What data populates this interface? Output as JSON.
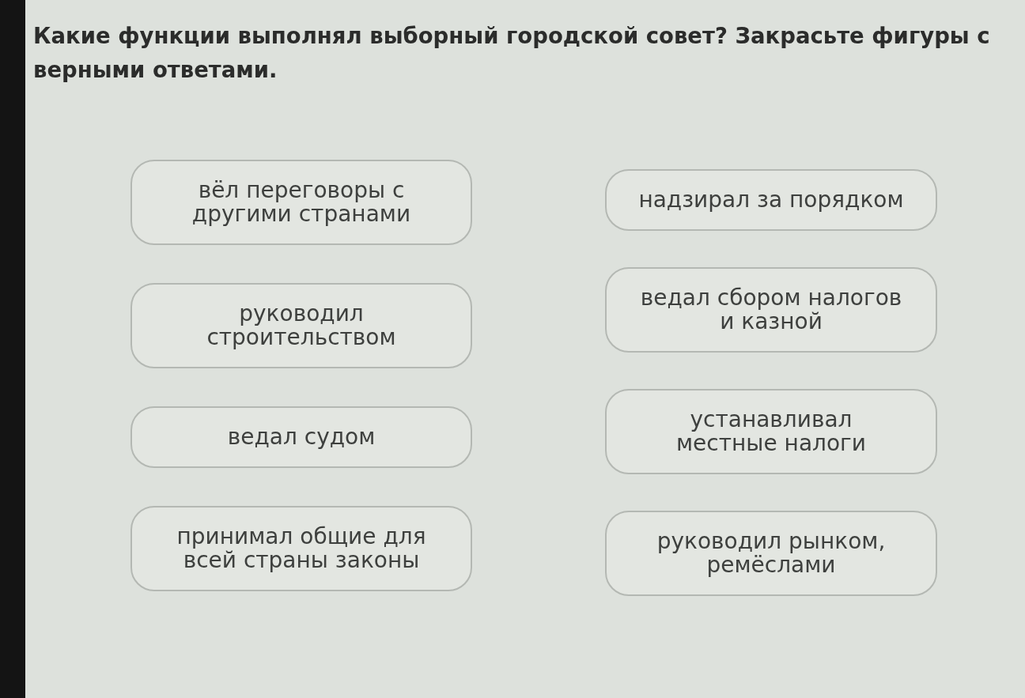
{
  "question": {
    "text": "Какие функции выполнял выборный городской совет? Закрасьте фигуры с верными ответами."
  },
  "options": [
    {
      "text": "вёл переговоры с другими странами",
      "selected": false
    },
    {
      "text": "руководил строительством",
      "selected": false
    },
    {
      "text": "ведал судом",
      "selected": false
    },
    {
      "text": "принимал общие для всей страны законы",
      "selected": false
    },
    {
      "text": "надзирал за порядком",
      "selected": false
    },
    {
      "text": "ведал сбором налогов и казной",
      "selected": false
    },
    {
      "text": "устанавливал местные налоги",
      "selected": false
    },
    {
      "text": "руководил рынком, ремёслами",
      "selected": false
    }
  ]
}
